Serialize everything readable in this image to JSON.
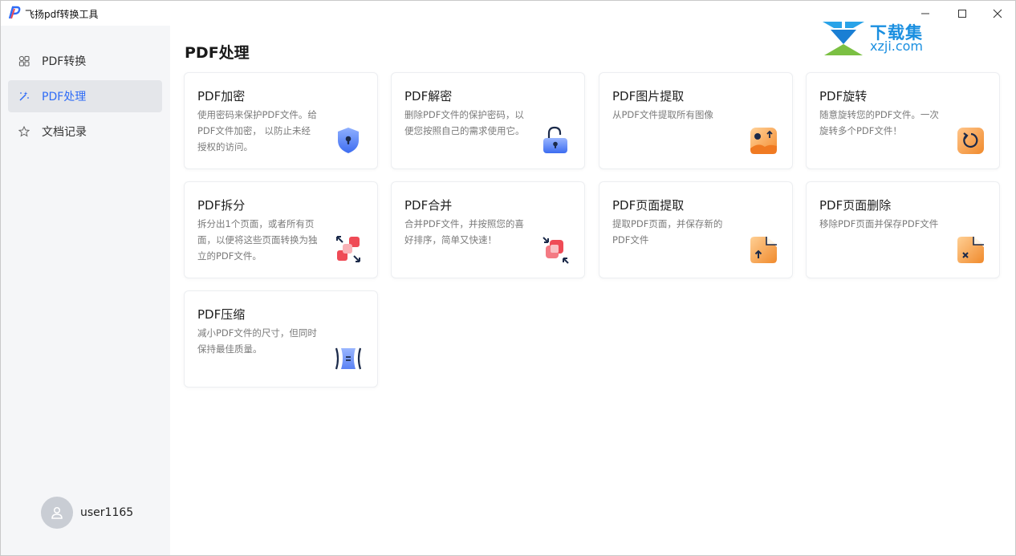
{
  "app": {
    "title": "飞扬pdf转换工具"
  },
  "sidebar": {
    "items": [
      {
        "label": "PDF转换",
        "icon": "layers-icon"
      },
      {
        "label": "PDF处理",
        "icon": "magic-wand-icon"
      },
      {
        "label": "文档记录",
        "icon": "star-icon"
      }
    ],
    "active_index": 1
  },
  "user": {
    "name": "user1165"
  },
  "main": {
    "title": "PDF处理"
  },
  "watermark": {
    "cn": "下载集",
    "en": "xzji.com"
  },
  "cards": [
    {
      "title": "PDF加密",
      "desc": "使用密码来保护PDF文件。给PDF文件加密， 以防止未经授权的访问。",
      "icon": "shield-lock-icon"
    },
    {
      "title": "PDF解密",
      "desc": "删除PDF文件的保护密码，以便您按照自己的需求使用它。",
      "icon": "unlock-icon"
    },
    {
      "title": "PDF图片提取",
      "desc": "从PDF文件提取所有图像",
      "icon": "image-extract-icon"
    },
    {
      "title": "PDF旋转",
      "desc": "随意旋转您的PDF文件。一次旋转多个PDF文件！",
      "icon": "rotate-icon"
    },
    {
      "title": "PDF拆分",
      "desc": "拆分出1个页面，或者所有页面，以便将这些页面转换为独立的PDF文件。",
      "icon": "split-icon"
    },
    {
      "title": "PDF合并",
      "desc": "合并PDF文件，并按照您的喜好排序，简单又快速！",
      "icon": "merge-icon"
    },
    {
      "title": "PDF页面提取",
      "desc": "提取PDF页面，并保存新的PDF文件",
      "icon": "page-extract-icon"
    },
    {
      "title": "PDF页面删除",
      "desc": "移除PDF页面并保存PDF文件",
      "icon": "page-delete-icon"
    },
    {
      "title": "PDF压缩",
      "desc": "减小PDF文件的尺寸，但同时保持最佳质量。",
      "icon": "compress-icon"
    }
  ],
  "colors": {
    "accent": "#2f6cf6",
    "sidebar_bg": "#f5f6f8",
    "active_item_bg": "#e4e6ea",
    "orange": "#f5a14a",
    "red": "#ef4b56",
    "blue": "#4c7cf2"
  }
}
